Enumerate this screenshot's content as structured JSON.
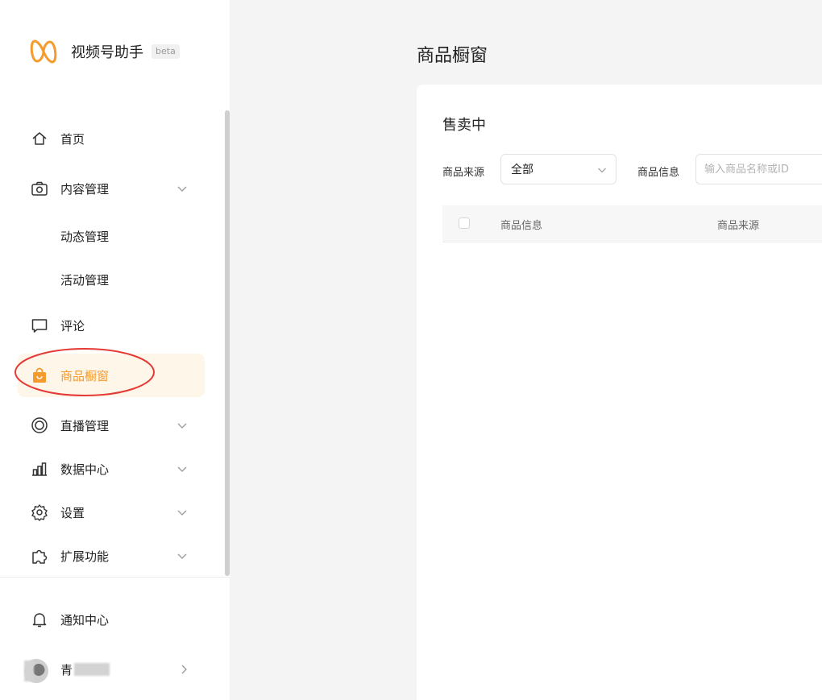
{
  "app": {
    "title": "视频号助手",
    "badge": "beta"
  },
  "sidebar": {
    "items": [
      {
        "label": "首页"
      },
      {
        "label": "内容管理",
        "sub": [
          "动态管理",
          "活动管理"
        ]
      },
      {
        "label": "评论"
      },
      {
        "label": "商品橱窗"
      },
      {
        "label": "直播管理"
      },
      {
        "label": "数据中心"
      },
      {
        "label": "设置"
      },
      {
        "label": "扩展功能"
      }
    ],
    "footer": {
      "notifications": "通知中心",
      "user_name": "青"
    }
  },
  "main": {
    "page_title": "商品橱窗",
    "card_title": "售卖中",
    "filters": {
      "source_label": "商品来源",
      "source_value": "全部",
      "info_label": "商品信息",
      "info_placeholder": "输入商品名称或ID"
    },
    "table": {
      "columns": [
        "商品信息",
        "商品来源"
      ]
    }
  },
  "colors": {
    "accent": "#f59a2c",
    "active_bg": "#fff6ea",
    "annotation": "#e53935"
  }
}
